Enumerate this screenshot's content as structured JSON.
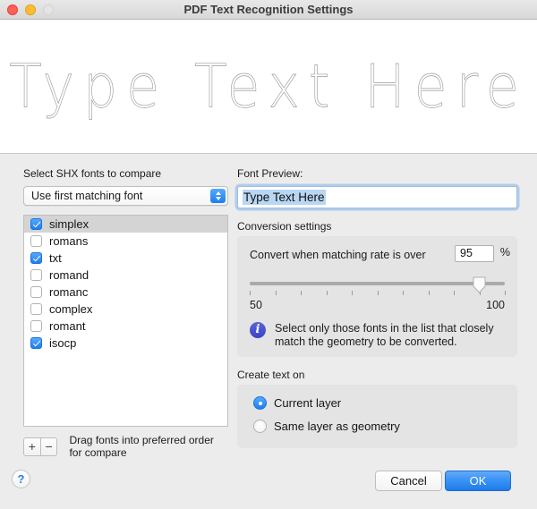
{
  "window": {
    "title": "PDF Text Recognition Settings",
    "traffic_lights": [
      {
        "name": "close",
        "color": "#ff5f57"
      },
      {
        "name": "minimize",
        "color": "#ffbd2e"
      },
      {
        "name": "zoom",
        "color": "#e4e4e4"
      }
    ]
  },
  "preview_banner": {
    "text": "Type Text Here"
  },
  "left": {
    "list_label": "Select SHX fonts to compare",
    "popup": {
      "value": "Use first matching font"
    },
    "fonts": [
      {
        "name": "simplex",
        "checked": true,
        "selected": true
      },
      {
        "name": "romans",
        "checked": false,
        "selected": false
      },
      {
        "name": "txt",
        "checked": true,
        "selected": false
      },
      {
        "name": "romand",
        "checked": false,
        "selected": false
      },
      {
        "name": "romanc",
        "checked": false,
        "selected": false
      },
      {
        "name": "complex",
        "checked": false,
        "selected": false
      },
      {
        "name": "romant",
        "checked": false,
        "selected": false
      },
      {
        "name": "isocp",
        "checked": true,
        "selected": false
      }
    ],
    "add_button": "+",
    "remove_button": "−",
    "drag_hint": "Drag fonts into preferred order for compare"
  },
  "right": {
    "font_preview_label": "Font Preview:",
    "font_preview_value": "Type Text Here",
    "conversion": {
      "title": "Conversion settings",
      "rate_label": "Convert when matching rate is over",
      "rate_value": "95",
      "percent_sign": "%",
      "slider_min": "50",
      "slider_max": "100",
      "slider_value": 95,
      "tick_count": 11,
      "info_icon": "i",
      "info_text": "Select only those fonts in the list that closely match the geometry to be converted."
    },
    "create_text_on": {
      "title": "Create text on",
      "options": [
        {
          "label": "Current layer",
          "selected": true
        },
        {
          "label": "Same layer as geometry",
          "selected": false
        }
      ]
    }
  },
  "footer": {
    "help": "?",
    "cancel": "Cancel",
    "ok": "OK"
  },
  "colors": {
    "accent_blue": "#1e7ef0",
    "window_bg": "#ececec",
    "group_bg": "#e4e4e4",
    "selection_gray": "#d4d4d4",
    "info_icon": "#3b44c4"
  }
}
